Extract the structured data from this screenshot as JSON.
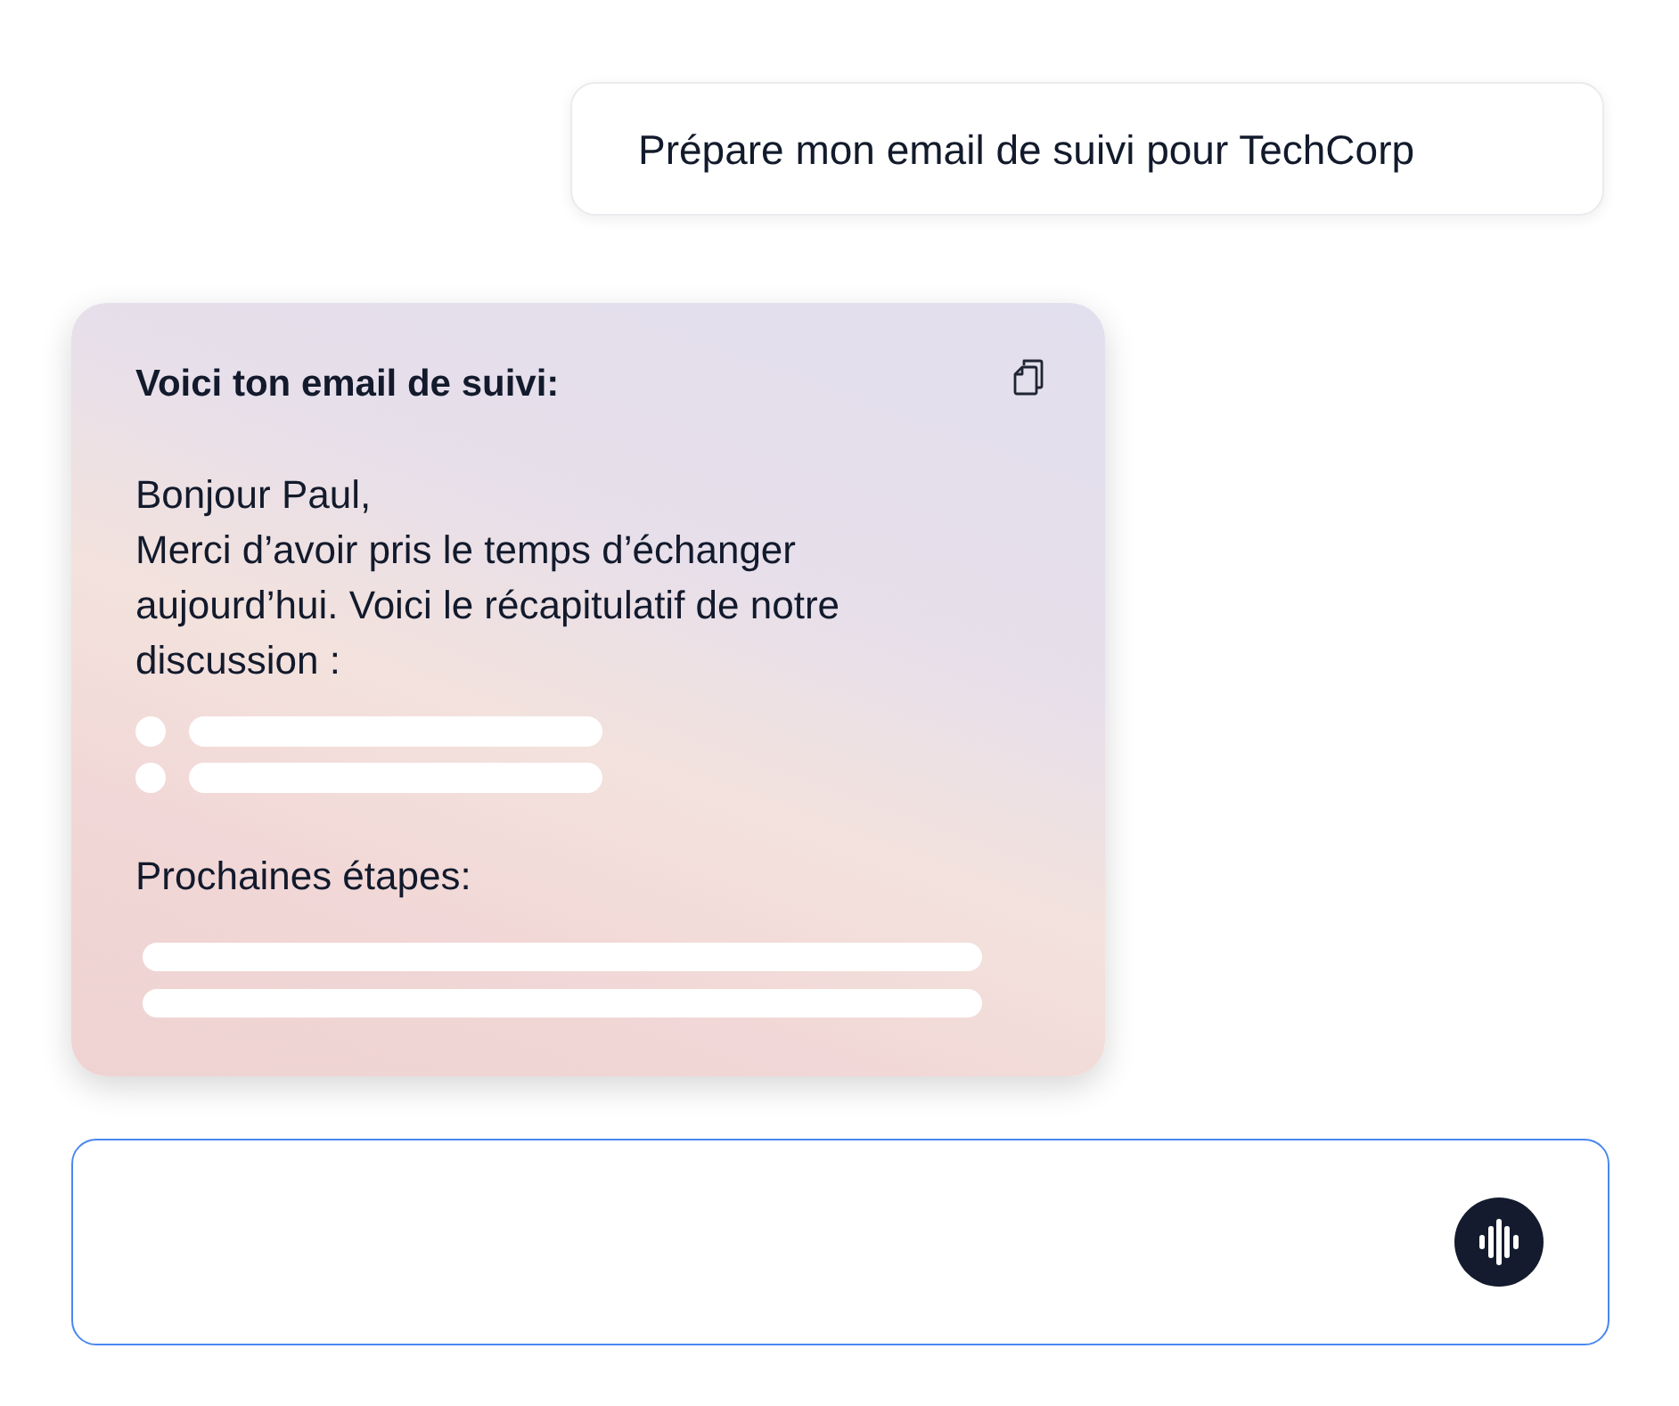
{
  "user_message": {
    "text": "Prépare mon email de suivi pour TechCorp"
  },
  "reply_card": {
    "title": "Voici ton email de suivi:",
    "greeting": "Bonjour Paul,",
    "body": "Merci d’avoir pris le temps d’échanger aujourd’hui. Voici le récapitulatif de notre discussion :",
    "summary_items": [
      {
        "kind": "placeholder"
      },
      {
        "kind": "placeholder"
      }
    ],
    "next_steps_heading": "Prochaines étapes:",
    "next_steps_items": [
      {
        "kind": "placeholder"
      },
      {
        "kind": "placeholder"
      }
    ]
  },
  "composer": {
    "focused": true
  }
}
